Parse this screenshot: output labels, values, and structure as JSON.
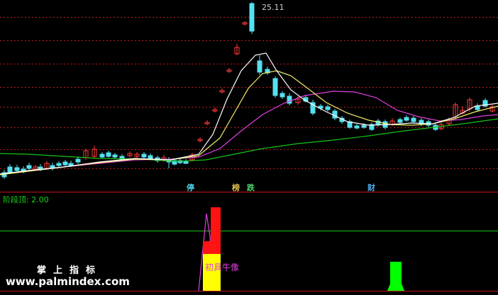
{
  "panel": {
    "indicator_label": "阶段顶: 2.00",
    "peak_price": "25.11",
    "markers": [
      "停",
      "榜",
      "跌",
      "财"
    ],
    "signal_label": "初具牛像"
  },
  "watermark": {
    "title": "掌上指标",
    "url": "www.palmindex.com"
  },
  "colors": {
    "background": "#000000",
    "grid": "#c01818",
    "up_candle": "#ff3c3c",
    "down_candle": "#54e0f0",
    "ma_short": "#ffffff",
    "ma_mid": "#f5f06a",
    "ma_long": "#e040e0",
    "ma_longest": "#17c417",
    "bar_red": "#ff1414",
    "bar_yellow": "#ffff00",
    "bar_green": "#00ff00"
  }
}
